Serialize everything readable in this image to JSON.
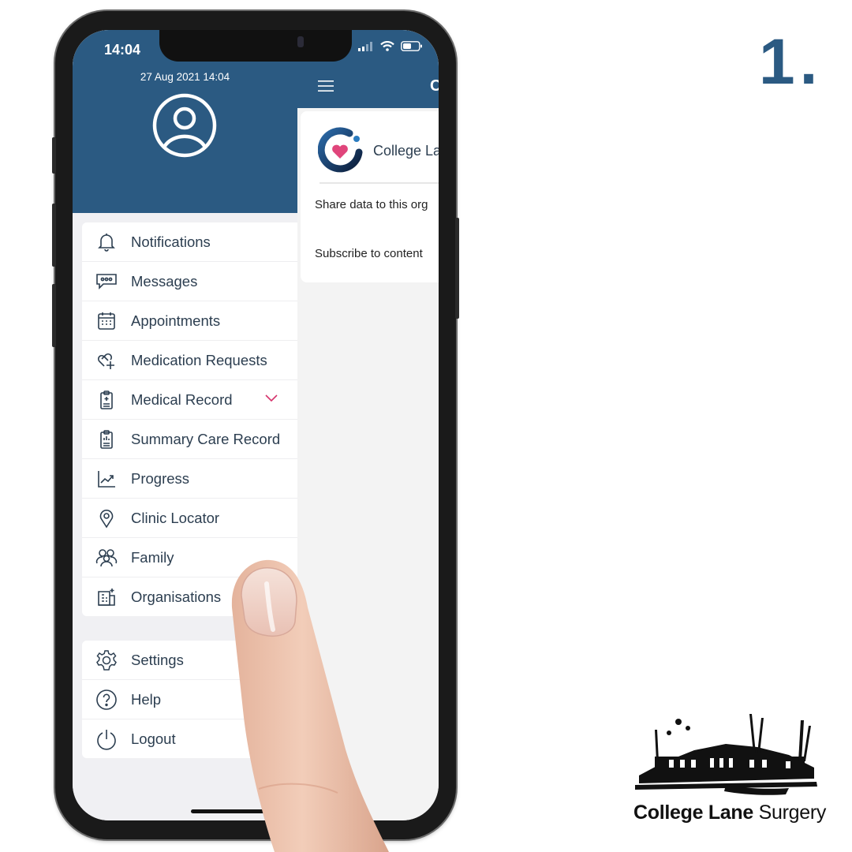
{
  "step": {
    "number": "1."
  },
  "status_bar": {
    "time": "14:04"
  },
  "drawer": {
    "date": "27 Aug 2021 14:04",
    "avatar_icon": "user-circle-icon",
    "primary_items": [
      {
        "label": "Notifications",
        "icon": "bell-icon"
      },
      {
        "label": "Messages",
        "icon": "chat-bubble-icon"
      },
      {
        "label": "Appointments",
        "icon": "calendar-icon"
      },
      {
        "label": "Medication Requests",
        "icon": "pill-plus-icon"
      },
      {
        "label": "Medical Record",
        "icon": "clipboard-plus-icon",
        "expandable": true
      },
      {
        "label": "Summary Care Record",
        "icon": "clipboard-chart-icon"
      },
      {
        "label": "Progress",
        "icon": "chart-line-icon"
      },
      {
        "label": "Clinic Locator",
        "icon": "map-pin-icon"
      },
      {
        "label": "Family",
        "icon": "family-icon"
      },
      {
        "label": "Organisations",
        "icon": "organisation-icon"
      }
    ],
    "secondary_items": [
      {
        "label": "Settings",
        "icon": "gear-icon"
      },
      {
        "label": "Help",
        "icon": "help-circle-icon"
      },
      {
        "label": "Logout",
        "icon": "power-icon"
      }
    ],
    "chevron_color": "#d6336c"
  },
  "main": {
    "title_partial": "C",
    "org_card": {
      "name_partial": "College La",
      "option_share": "Share data to this org",
      "option_subscribe": "Subscribe to content"
    }
  },
  "brand": {
    "name_bold": "College Lane",
    "name_light": " Surgery"
  },
  "colors": {
    "primary": "#2b5a82",
    "accent": "#d6336c",
    "text": "#2c3e50"
  }
}
